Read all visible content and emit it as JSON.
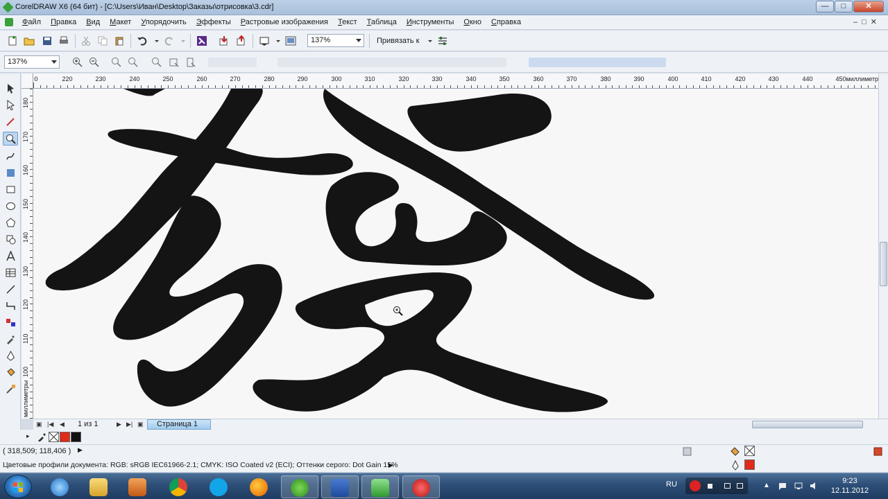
{
  "window": {
    "title": "CorelDRAW X6 (64 бит) - [C:\\Users\\Иван\\Desktop\\Заказы\\отрисовка\\3.cdr]",
    "minimize": "—",
    "maximize": "□",
    "close": "✕"
  },
  "menu": {
    "items": [
      "Файл",
      "Правка",
      "Вид",
      "Макет",
      "Упорядочить",
      "Эффекты",
      "Растровые изображения",
      "Текст",
      "Таблица",
      "Инструменты",
      "Окно",
      "Справка"
    ],
    "doc_controls": "–□✕"
  },
  "standard_toolbar": {
    "zoom_value": "137%",
    "snap_label": "Привязать к"
  },
  "property_bar": {
    "zoom_value": "137%"
  },
  "ruler": {
    "unit": "миллиметры",
    "h_labels": [
      "0",
      "220",
      "230",
      "240",
      "250",
      "260",
      "270",
      "280",
      "290",
      "300",
      "310",
      "320",
      "330",
      "340",
      "350",
      "360",
      "370",
      "380",
      "390",
      "400",
      "410",
      "420",
      "430",
      "440",
      "450"
    ],
    "v_labels": [
      "180",
      "170",
      "160",
      "150",
      "140",
      "130",
      "120",
      "110",
      "100"
    ],
    "v_unit": "миллиметры"
  },
  "page_nav": {
    "count": "1 из 1",
    "tab": "Страница 1"
  },
  "palette": {
    "fill_color": "#e02a1a",
    "outline_color": "#111111"
  },
  "status": {
    "coords": "( 318,509; 118,406 )",
    "profiles": "Цветовые профили документа: RGB: sRGB IEC61966-2.1; CMYK: ISO Coated v2 (ECI); Оттенки серого: Dot Gain 15%"
  },
  "colors": {
    "glyph": "#141414",
    "canvas": "#f7f7f7",
    "accent": "#3aa03a"
  },
  "taskbar": {
    "lang": "RU",
    "time": "9:23",
    "date": "12.11.2012",
    "apps": [
      "internet-explorer",
      "file-explorer",
      "media-player",
      "chrome",
      "skype",
      "firefox",
      "utorrent",
      "word",
      "coreldraw",
      "recorder"
    ]
  }
}
